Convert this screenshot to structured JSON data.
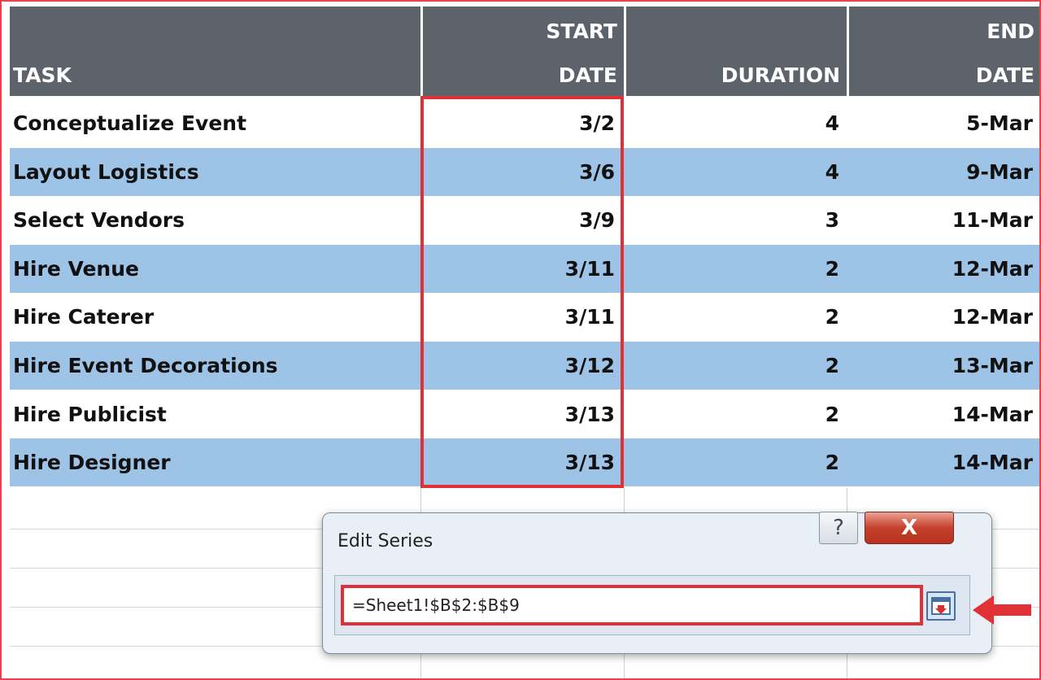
{
  "table": {
    "headers": {
      "task": "TASK",
      "start_line1": "START",
      "start_line2": "DATE",
      "duration": "DURATION",
      "end_line1": "END",
      "end_line2": "DATE"
    },
    "rows": [
      {
        "task": "Conceptualize Event",
        "start": "3/2",
        "duration": "4",
        "end": "5-Mar"
      },
      {
        "task": "Layout Logistics",
        "start": "3/6",
        "duration": "4",
        "end": "9-Mar"
      },
      {
        "task": "Select Vendors",
        "start": "3/9",
        "duration": "3",
        "end": "11-Mar"
      },
      {
        "task": "Hire Venue",
        "start": "3/11",
        "duration": "2",
        "end": "12-Mar"
      },
      {
        "task": "Hire Caterer",
        "start": "3/11",
        "duration": "2",
        "end": "12-Mar"
      },
      {
        "task": "Hire Event Decorations",
        "start": "3/12",
        "duration": "2",
        "end": "13-Mar"
      },
      {
        "task": "Hire Publicist",
        "start": "3/13",
        "duration": "2",
        "end": "14-Mar"
      },
      {
        "task": "Hire Designer",
        "start": "3/13",
        "duration": "2",
        "end": "14-Mar"
      }
    ]
  },
  "dialog": {
    "title": "Edit Series",
    "help_label": "?",
    "close_label": "X",
    "range_value": "=Sheet1!$B$2:$B$9",
    "collapse_icon": "collapse-dialog-icon"
  },
  "colors": {
    "header_bg": "#5c636a",
    "band_bg": "#9dc3e6",
    "highlight": "#e03137"
  }
}
